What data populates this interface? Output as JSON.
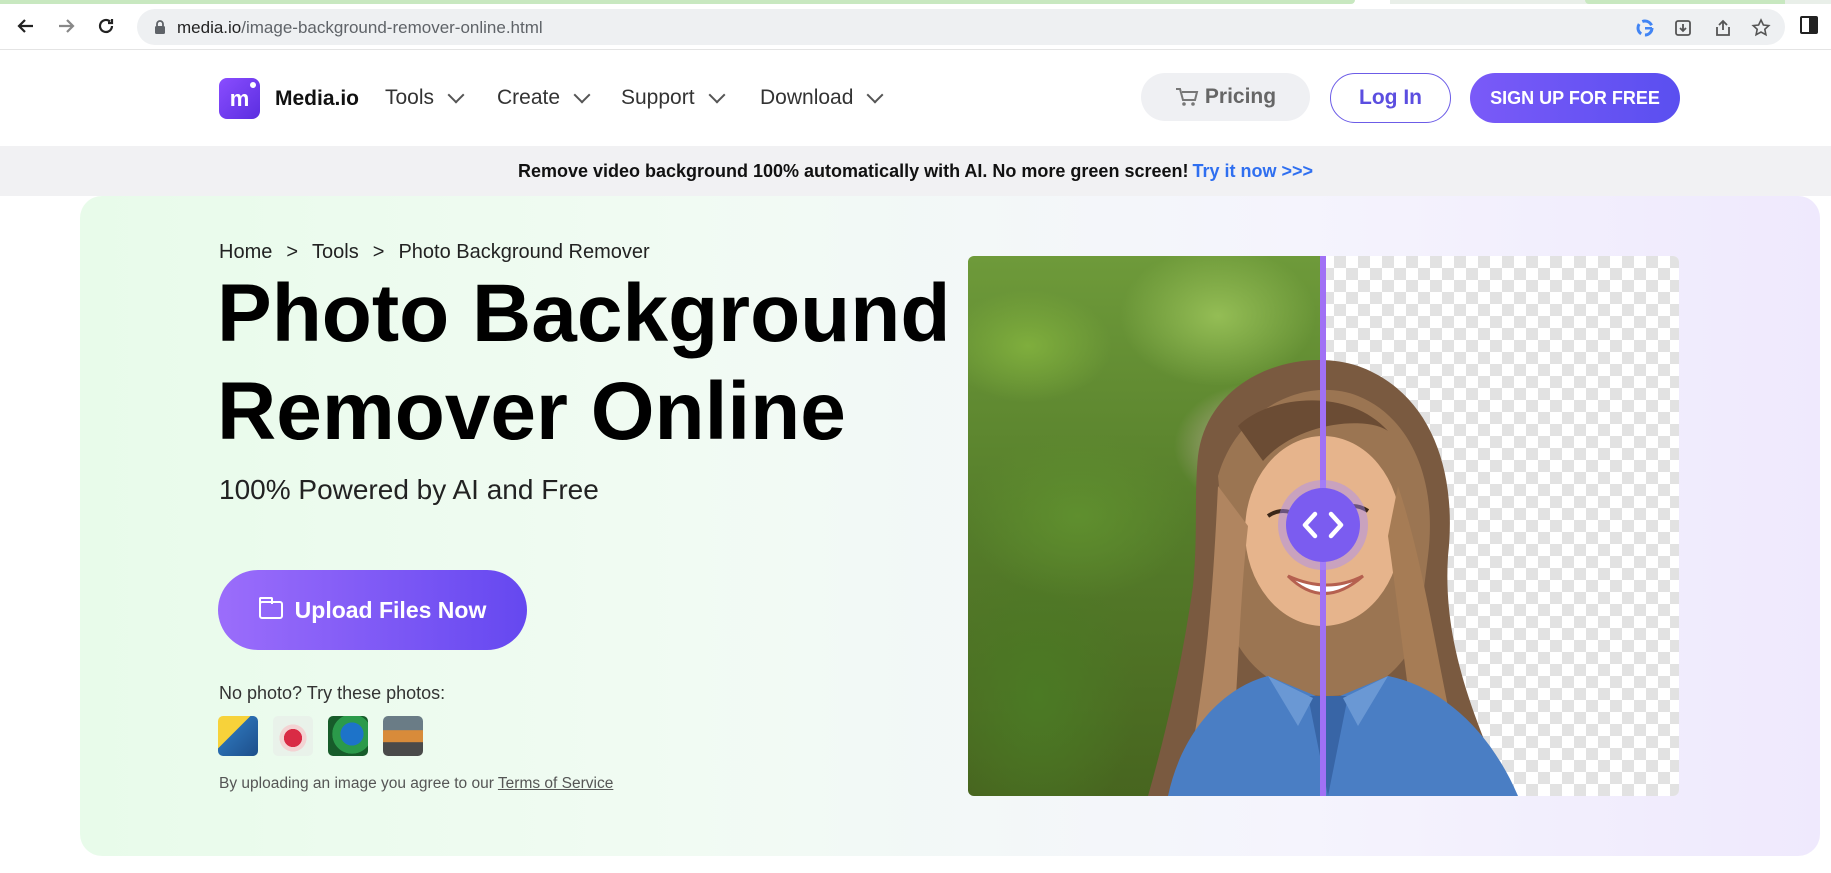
{
  "browser": {
    "url_host": "media.io",
    "url_path": "/image-background-remover-online.html"
  },
  "header": {
    "brand": "Media.io",
    "nav": [
      {
        "label": "Tools"
      },
      {
        "label": "Create"
      },
      {
        "label": "Support"
      },
      {
        "label": "Download"
      }
    ],
    "pricing_label": "Pricing",
    "login_label": "Log In",
    "signup_label": "SIGN UP FOR FREE"
  },
  "announcement": {
    "text": "Remove video background 100% automatically with AI. No more green screen!",
    "link": "Try it now >>>"
  },
  "breadcrumb": {
    "items": [
      "Home",
      "Tools",
      "Photo Background Remover"
    ],
    "separator": ">"
  },
  "hero": {
    "title_line1": "Photo Background",
    "title_line2": "Remover Online",
    "subtitle": "100% Powered by AI and Free",
    "upload_label": "Upload Files Now",
    "no_photo_text": "No photo? Try these photos:",
    "terms_prefix": "By uploading an image you agree to our",
    "terms_link": "Terms of Service"
  },
  "comparison": {
    "handle_glyph": "< >",
    "accent": "#7b5cf0"
  },
  "colors": {
    "brand_purple": "#6548f0",
    "link_blue": "#2f6ff0"
  }
}
